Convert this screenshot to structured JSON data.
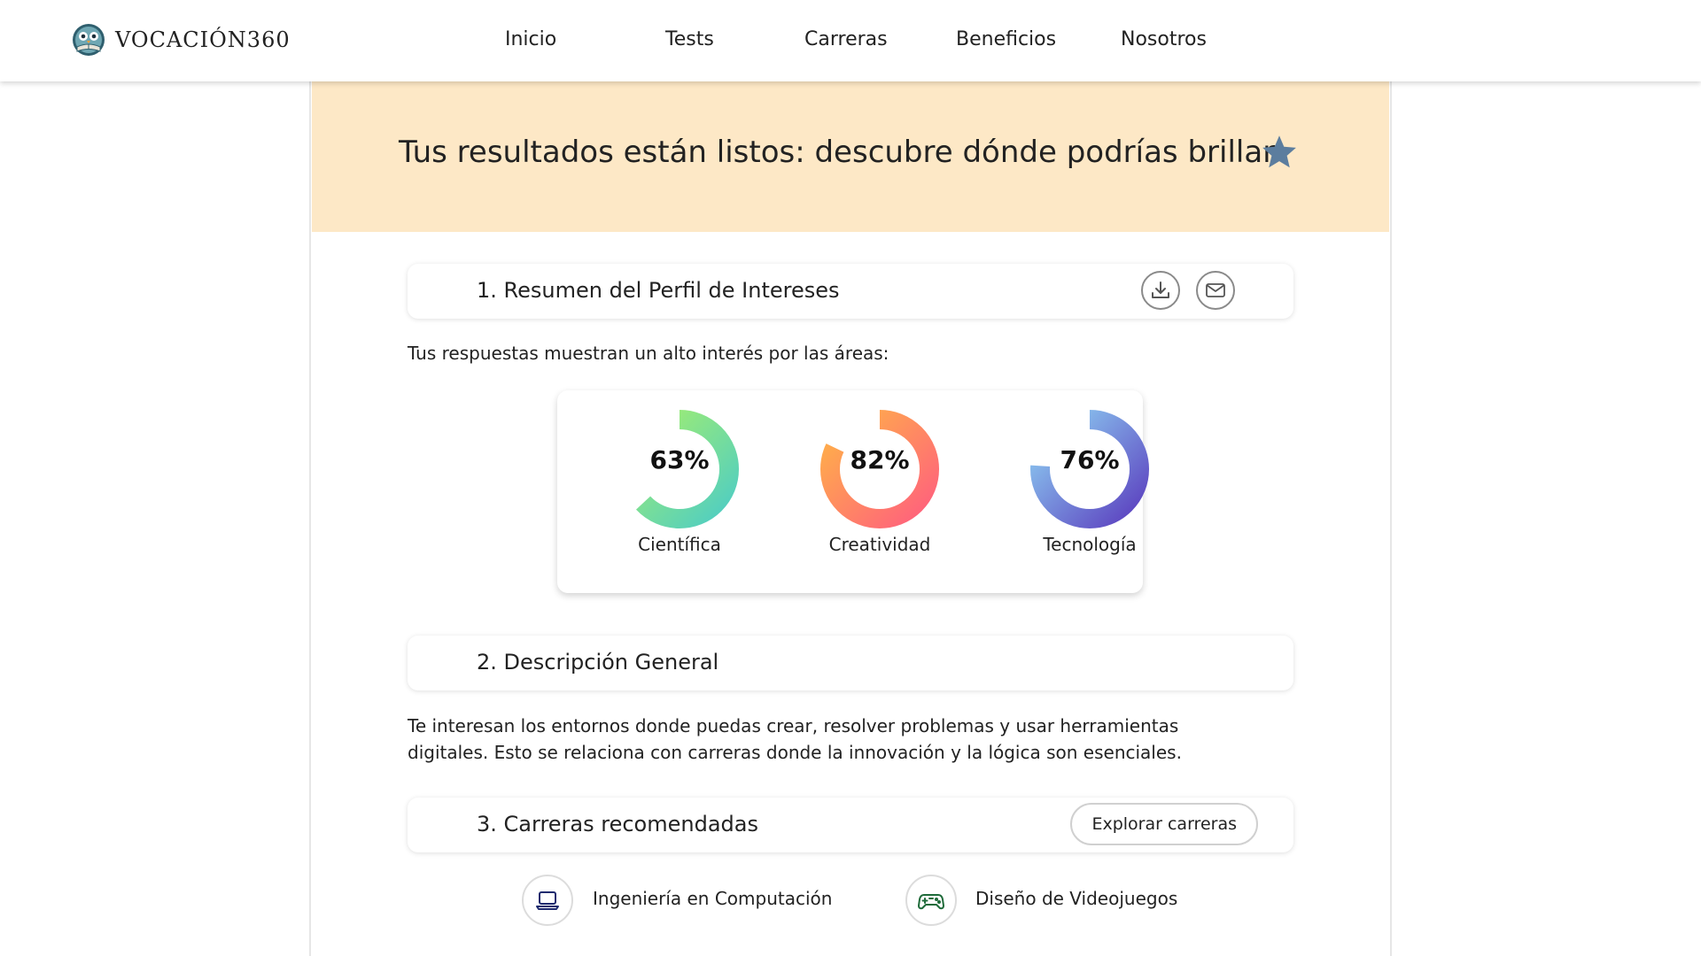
{
  "header": {
    "logo_text": "VOCACIÓN360",
    "logo_icon": "owl-book-icon",
    "nav": [
      "Inicio",
      "Tests",
      "Carreras",
      "Beneficios",
      "Nosotros"
    ]
  },
  "banner": {
    "title": "Tus resultados están listos: descubre dónde podrías brillar",
    "icon": "star-icon",
    "background": "#fde8c6"
  },
  "section1": {
    "title": "1. Resumen del Perfil de Intereses",
    "actions": [
      "download-icon",
      "mail-icon"
    ],
    "intro": "Tus respuestas muestran un alto interés por las áreas:",
    "areas": [
      {
        "label": "Científica",
        "percent": "63%",
        "value": 63,
        "gradient": [
          "#4ecdc4",
          "#a8f06a"
        ]
      },
      {
        "label": "Creatividad",
        "percent": "82%",
        "value": 82,
        "gradient": [
          "#ff5f7e",
          "#ffb347"
        ]
      },
      {
        "label": "Tecnología",
        "percent": "76%",
        "value": 76,
        "gradient": [
          "#5b3fbf",
          "#8fd3f4"
        ]
      }
    ]
  },
  "section2": {
    "title": "2. Descripción General",
    "line1": "Te interesan los entornos donde puedas crear, resolver problemas y usar herramientas",
    "line2": "digitales. Esto se relaciona con carreras donde la innovación y la lógica son esenciales."
  },
  "section3": {
    "title": "3. Carreras recomendadas",
    "button": "Explorar carreras",
    "careers": [
      {
        "label": "Ingeniería en Computación",
        "icon": "laptop-icon",
        "color": "#1e2a6e"
      },
      {
        "label": "Diseño de Videojuegos",
        "icon": "gamepad-icon",
        "color": "#1f6b3a"
      }
    ]
  }
}
